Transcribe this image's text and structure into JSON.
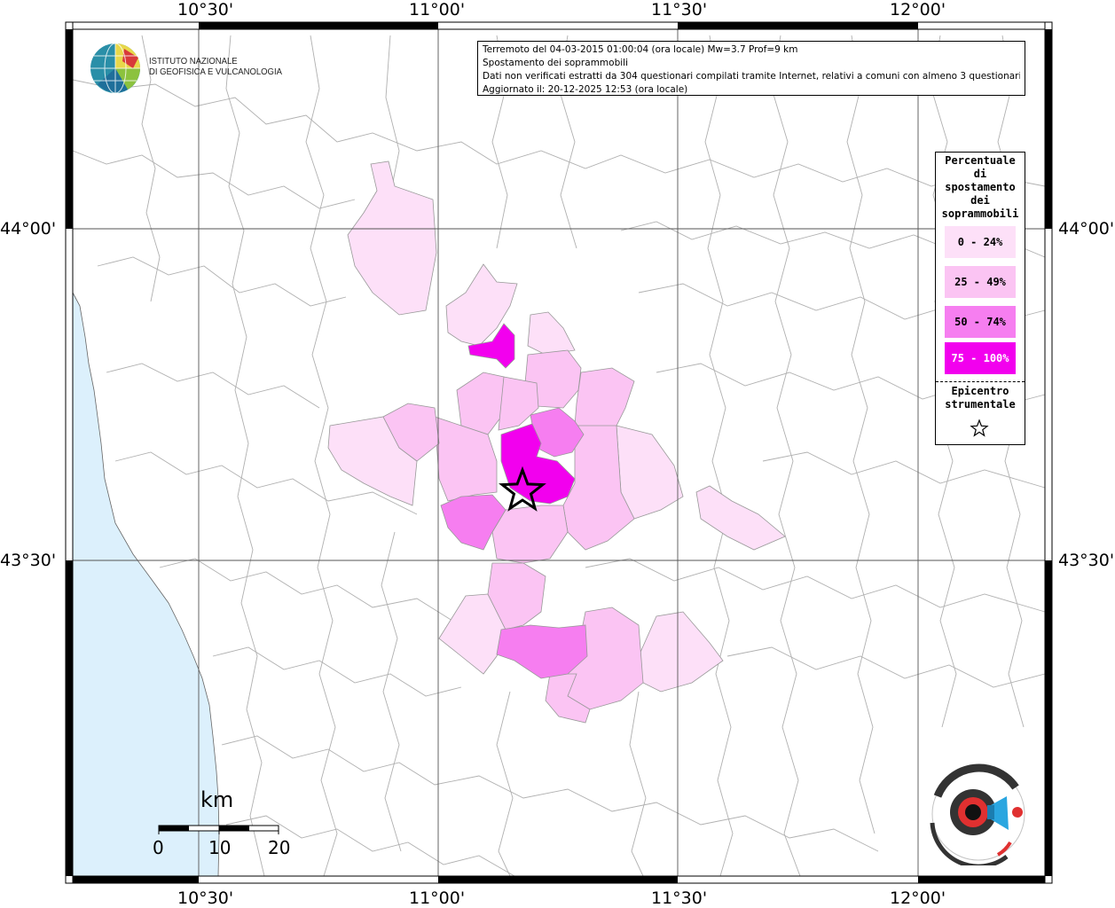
{
  "coords": {
    "top": [
      "10°30'",
      "11°00'",
      "11°30'",
      "12°00'"
    ],
    "bottom": [
      "10°30'",
      "11°00'",
      "11°30'",
      "12°00'"
    ],
    "left": [
      "44°00'",
      "43°30'"
    ],
    "right": [
      "44°00'",
      "43°30'"
    ]
  },
  "info": {
    "line1": "Terremoto del 04-03-2015 01:00:04 (ora locale) Mw=3.7 Prof=9 km",
    "line2": "Spostamento dei soprammobili",
    "line3": "Dati non verificati estratti da 304 questionari compilati tramite Internet, relativi a comuni con almeno 3 questionari.",
    "line4": "Aggiornato il: 20-12-2025 12:53 (ora locale)"
  },
  "logo": {
    "line1": "ISTITUTO NAZIONALE",
    "line2": "DI GEOFISICA E VULCANOLOGIA"
  },
  "legend": {
    "title": [
      "Percentuale",
      "di",
      "spostamento",
      "dei",
      "soprammobili"
    ],
    "items": [
      {
        "label": "0 - 24%",
        "color": "#fde0f8"
      },
      {
        "label": "25 - 49%",
        "color": "#fbc4f3"
      },
      {
        "label": "50 - 74%",
        "color": "#f67ef0"
      },
      {
        "label": "75 - 100%",
        "color": "#f200ee"
      }
    ],
    "epicenter": [
      "Epicentro",
      "strumentale"
    ]
  },
  "scale": {
    "unit": "km",
    "labels": [
      "0",
      "10",
      "20"
    ]
  },
  "colors": {
    "sea": "#dcf0fc",
    "land": "#ffffff",
    "border": "#aaaaaa",
    "grid": "#555555",
    "class1": "#fde0f8",
    "class2": "#fbc4f3",
    "class3": "#f67ef0",
    "class4": "#f200ee"
  },
  "icons": [
    "ingv-globe-icon",
    "epicenter-star-icon",
    "haisentito-logo-icon"
  ]
}
